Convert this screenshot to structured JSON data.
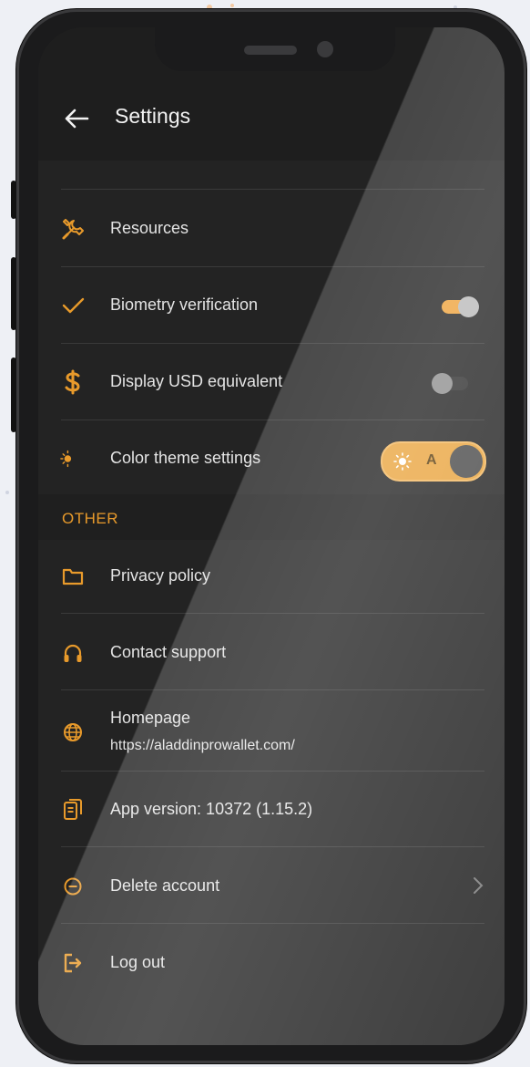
{
  "header": {
    "title": "Settings"
  },
  "rows": [
    {
      "label": "Resources",
      "icon": "tools-icon"
    },
    {
      "label": "Biometry verification",
      "icon": "check-icon",
      "toggle": true
    },
    {
      "label": "Display USD equivalent",
      "icon": "dollar-icon",
      "toggle": false
    },
    {
      "label": "Color theme settings",
      "icon": "theme-icon",
      "theme_mode_label": "A"
    }
  ],
  "other": {
    "section_title": "OTHER",
    "items": [
      {
        "label": "Privacy policy",
        "icon": "folder-icon"
      },
      {
        "label": "Contact support",
        "icon": "headphones-icon"
      },
      {
        "label": "Homepage",
        "sub": "https://aladdinprowallet.com/",
        "icon": "globe-icon"
      },
      {
        "label": "App version: 10372 (1.15.2)",
        "icon": "document-icon"
      },
      {
        "label": "Delete account",
        "icon": "minus-circle-icon"
      },
      {
        "label": "Log out",
        "icon": "logout-icon"
      }
    ]
  },
  "colors": {
    "accent": "#e89a2b",
    "background": "#232323",
    "header": "#1e1e1e"
  }
}
